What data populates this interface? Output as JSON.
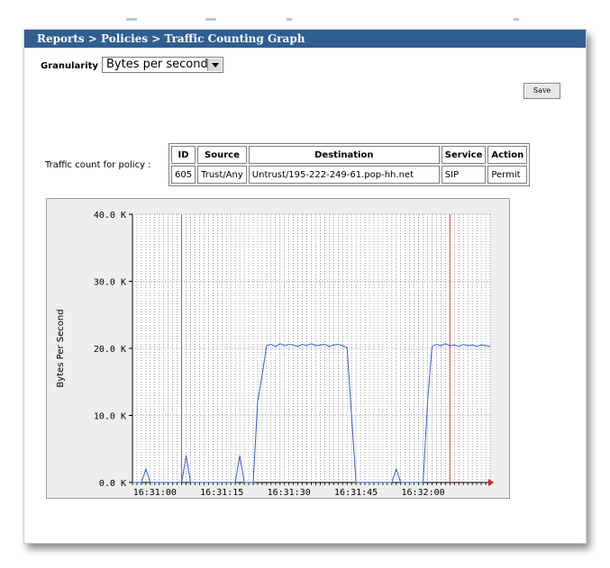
{
  "breadcrumb": "Reports > Policies > Traffic Counting Graph",
  "granularity": {
    "label": "Granularity",
    "selected": "Bytes per second"
  },
  "save_label": "Save",
  "policy": {
    "label": "Traffic count for policy :",
    "headers": [
      "ID",
      "Source",
      "Destination",
      "Service",
      "Action"
    ],
    "row": [
      "605",
      "Trust/Any",
      "Untrust/195-222-249-61.pop-hh.net",
      "SIP",
      "Permit"
    ]
  },
  "chart_data": {
    "type": "line",
    "ylabel": "Bytes Per Second",
    "ylim": [
      0,
      40000
    ],
    "yticks": [
      0,
      10000,
      20000,
      30000,
      40000
    ],
    "ytick_labels": [
      "0.0 K",
      "10.0 K",
      "20.0 K",
      "30.0 K",
      "40.0 K"
    ],
    "xlim": [
      0,
      80
    ],
    "xticks": [
      5,
      20,
      35,
      50,
      65
    ],
    "xtick_labels": [
      "16:31:00",
      "16:31:15",
      "16:31:30",
      "16:31:45",
      "16:32:00"
    ],
    "grid": true,
    "markers_x": [
      11,
      71
    ],
    "marker_color": "#d84040",
    "line_color": "#3060d0",
    "series": [
      {
        "x": [
          0,
          1,
          2,
          3,
          4,
          5,
          11,
          12,
          13,
          23,
          24,
          25,
          27,
          28,
          29,
          30,
          31,
          32,
          33,
          34,
          35,
          36,
          37,
          38,
          39,
          40,
          41,
          42,
          43,
          44,
          45,
          46,
          47,
          48,
          50,
          51,
          52,
          58,
          59,
          60,
          65,
          66,
          67,
          68,
          69,
          70,
          71,
          72,
          73,
          74,
          75,
          76,
          77,
          78,
          79,
          80
        ],
        "y": [
          0,
          0,
          0,
          2000,
          0,
          0,
          0,
          4000,
          0,
          0,
          4000,
          0,
          0,
          12000,
          16000,
          20400,
          20600,
          20300,
          20700,
          20400,
          20600,
          20500,
          20300,
          20600,
          20400,
          20700,
          20400,
          20500,
          20600,
          20300,
          20500,
          20600,
          20400,
          20100,
          0,
          0,
          0,
          0,
          2000,
          0,
          0,
          12000,
          20300,
          20600,
          20400,
          20700,
          20400,
          20500,
          20300,
          20600,
          20400,
          20500,
          20300,
          20500,
          20400,
          20300
        ]
      }
    ]
  }
}
